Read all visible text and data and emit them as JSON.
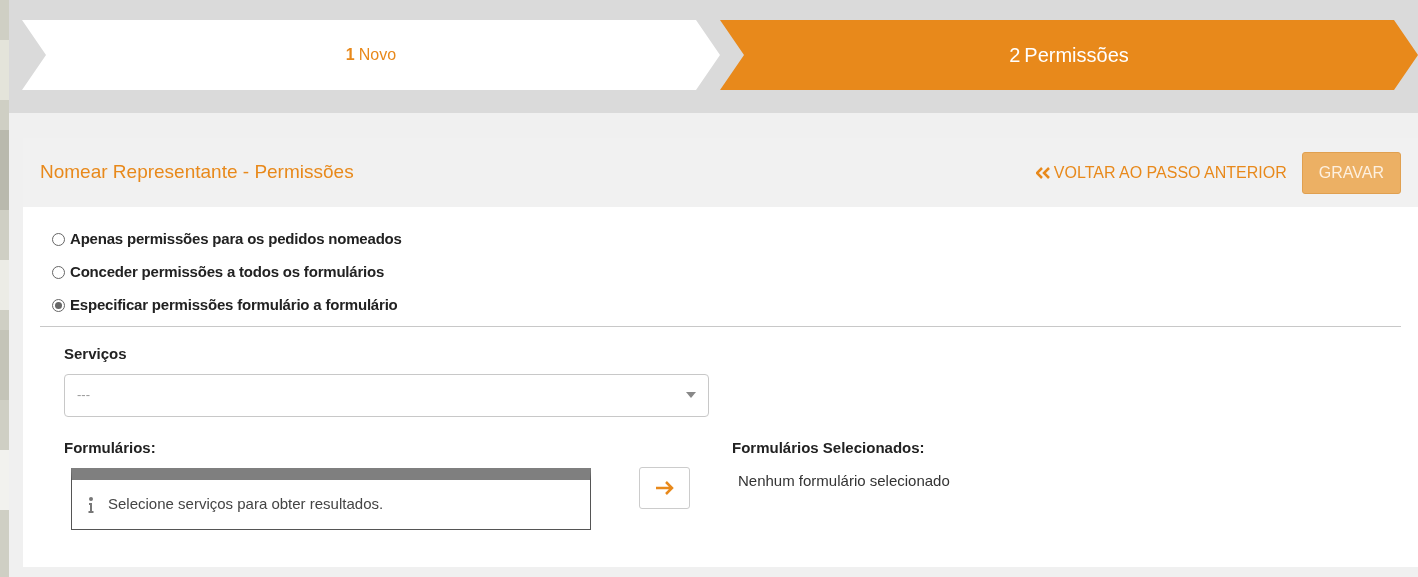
{
  "steps": [
    {
      "number": "1",
      "label": "Novo",
      "selected": false
    },
    {
      "number": "2",
      "label": "Permissões",
      "selected": true
    }
  ],
  "panel": {
    "title": "Nomear Representante - Permissões",
    "back_link": "VOLTAR AO PASSO ANTERIOR",
    "save_button": {
      "label": "GRAVAR",
      "disabled": true
    }
  },
  "permission_options": [
    {
      "label": "Apenas permissões para os pedidos nomeados",
      "selected": false
    },
    {
      "label": "Conceder permissões a todos os formulários",
      "selected": false
    },
    {
      "label": "Especificar permissões formulário a formulário",
      "selected": true
    }
  ],
  "services": {
    "label": "Serviços",
    "value": "---"
  },
  "forms": {
    "label": "Formulários:",
    "message": "Selecione serviços para obter resultados."
  },
  "selected_forms": {
    "label": "Formulários Selecionados:",
    "message": "Nenhum formulário selecionado"
  }
}
